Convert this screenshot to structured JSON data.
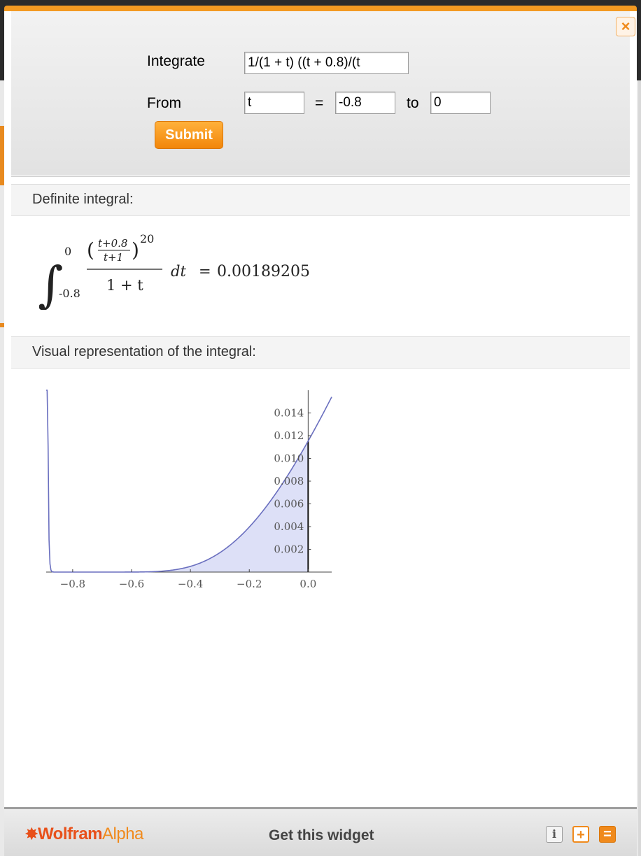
{
  "widget": {
    "close_label": "×",
    "form": {
      "integrate_label": "Integrate",
      "integrand_value": "1/(1 + t) ((t + 0.8)/(t",
      "from_label": "From",
      "variable_value": "t",
      "equals_label": "=",
      "lower_value": "-0.8",
      "to_label": "to",
      "upper_value": "0",
      "submit_label": "Submit"
    },
    "pods": {
      "definite_title": "Definite integral:",
      "visual_title": "Visual representation of the integral:"
    },
    "result": {
      "upper_limit": "0",
      "lower_limit": "-0.8",
      "numerator_top": "t+0.8",
      "numerator_bottom": "t+1",
      "exponent": "20",
      "denominator": "1 + t",
      "differential": "dt",
      "equals": "=",
      "value": "0.00189205"
    },
    "footer": {
      "brand_main": "Wolfram",
      "brand_alpha": "Alpha",
      "get_widget_label": "Get this widget",
      "info_label": "i",
      "plus_label": "+",
      "minimize_label": "="
    },
    "colors": {
      "accent": "#f39a22",
      "curve": "#6a6fbf",
      "fill": "#dde0f7"
    }
  },
  "chart_data": {
    "type": "area",
    "x_ticks": [
      "-0.8",
      "-0.6",
      "-0.4",
      "-0.2",
      "0.0"
    ],
    "y_ticks": [
      "0.002",
      "0.004",
      "0.006",
      "0.008",
      "0.010",
      "0.012",
      "0.014"
    ],
    "xlim": [
      -0.89,
      0.08
    ],
    "ylim": [
      0,
      0.016
    ],
    "shaded_interval": [
      -0.8,
      0
    ],
    "function": "((t+0.8)/(t+1))^20/(1+t)",
    "grid": false
  }
}
